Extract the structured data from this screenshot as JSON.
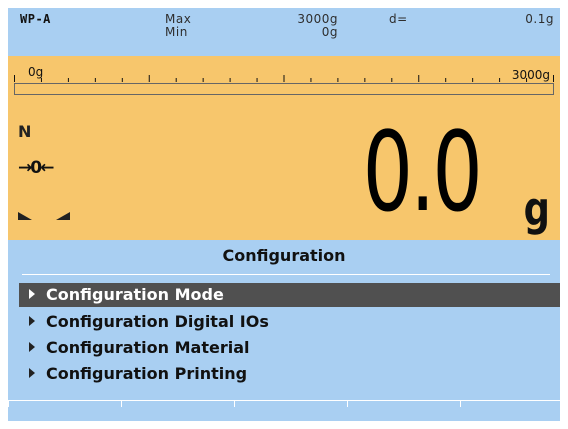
{
  "header": {
    "model": "WP-A",
    "max_label": "Max",
    "min_label": "Min",
    "max_value": "3000g",
    "min_value": "0g",
    "d_label": "d=",
    "d_value": "0.1g"
  },
  "scale": {
    "min_label": "0g",
    "max_label": "3000g",
    "fill_fraction": 0
  },
  "weighing": {
    "mode": "N",
    "zero_indicator": "→0←",
    "value": "0.0",
    "unit": "g"
  },
  "menu": {
    "title": "Configuration",
    "items": [
      {
        "label": "Configuration Mode",
        "selected": true
      },
      {
        "label": "Configuration Digital IOs",
        "selected": false
      },
      {
        "label": "Configuration Material",
        "selected": false
      },
      {
        "label": "Configuration Printing",
        "selected": false
      }
    ]
  },
  "softkeys": [
    "",
    "",
    "",
    "",
    ""
  ],
  "colors": {
    "screen_bg": "#a9cff2",
    "weigh_panel": "#f7c66c",
    "selected_row": "#505050"
  }
}
